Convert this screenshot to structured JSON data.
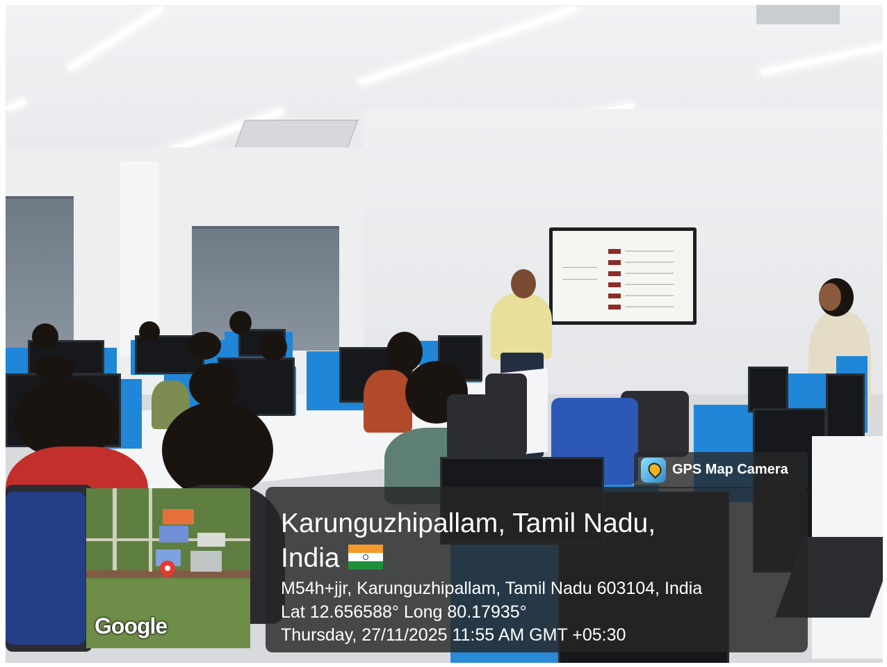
{
  "overlay": {
    "app_name": "GPS Map Camera",
    "location_title_line1": "Karunguzhipallam, Tamil Nadu,",
    "location_title_line2": "India",
    "flag_icon": "india-flag-icon",
    "address": "M54h+jjr, Karunguzhipallam, Tamil Nadu 603104, India",
    "coordinates": "Lat 12.656588° Long 80.17935°",
    "datetime": "Thursday, 27/11/2025 11:55 AM GMT +05:30",
    "map_attribution": "Google"
  },
  "scene": {
    "colors": {
      "partition_blue": "#1f86d8",
      "chair_blue": "#2d59b6",
      "slide_accent": "#8a2c28"
    }
  }
}
